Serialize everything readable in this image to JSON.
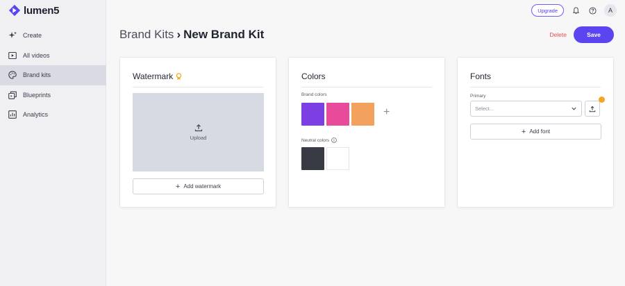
{
  "app": {
    "name": "lumen5"
  },
  "sidebar": {
    "items": [
      {
        "label": "Create",
        "icon": "sparkle-icon"
      },
      {
        "label": "All videos",
        "icon": "video-icon"
      },
      {
        "label": "Brand kits",
        "icon": "palette-icon",
        "active": true
      },
      {
        "label": "Blueprints",
        "icon": "blueprint-icon"
      },
      {
        "label": "Analytics",
        "icon": "analytics-icon"
      }
    ]
  },
  "topbar": {
    "upgrade_label": "Upgrade",
    "avatar_initial": "A"
  },
  "header": {
    "parent": "Brand Kits",
    "separator": "›",
    "current": "New Brand Kit",
    "delete_label": "Delete",
    "save_label": "Save"
  },
  "watermark": {
    "title": "Watermark",
    "upload_label": "Upload",
    "add_label": "Add watermark"
  },
  "colors": {
    "title": "Colors",
    "brand_label": "Brand colors",
    "brand_swatches": [
      "#7b3fe4",
      "#e94b9b",
      "#f2a25c"
    ],
    "neutral_label": "Neutral colors",
    "neutral_swatches": [
      "#383b44",
      "#ffffff"
    ]
  },
  "fonts": {
    "title": "Fonts",
    "primary_label": "Primary",
    "select_placeholder": "Select...",
    "add_label": "Add font"
  },
  "theme": {
    "accent": "#5a45f0",
    "danger": "#e84b4b",
    "badge": "#f5a623"
  }
}
